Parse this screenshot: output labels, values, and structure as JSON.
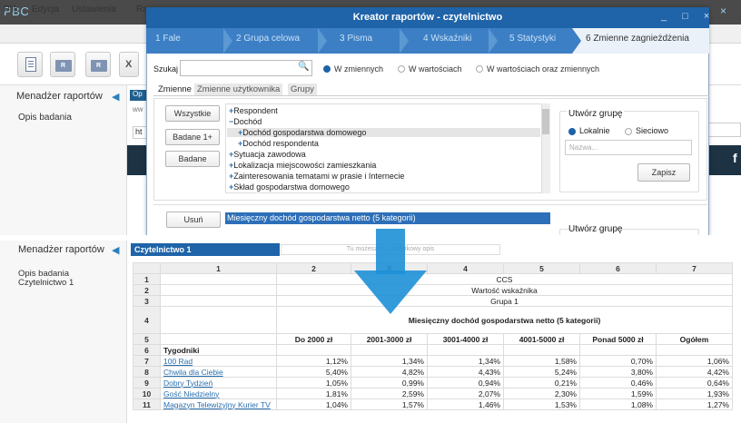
{
  "app": {
    "logo": "PBC",
    "window_controls": "_ □ ×"
  },
  "menu": [
    "Plik",
    "Edycja",
    "Ustawienia",
    "Ra"
  ],
  "toolbar": {
    "btn2_label": "R",
    "btn3_label": "R",
    "btn4_label": "X"
  },
  "top_panel": {
    "title": "Menadżer raportów",
    "item": "Opis badania",
    "strip_tab": "Op",
    "strip_ww": "ww",
    "strip_ht": "ht",
    "dark_letter": "f"
  },
  "dialog": {
    "title": "Kreator raportów - czytelnictwo",
    "controls": "_ □ ×",
    "steps": [
      "1 Fale",
      "2 Grupa celowa",
      "3 Pisma",
      "4 Wskaźniki",
      "5 Statystyki",
      "6 Zmienne zagnieżdżenia"
    ],
    "search": {
      "label": "Szukaj",
      "value": ""
    },
    "radios": [
      "W zmiennych",
      "W wartościach",
      "W wartościach oraz zmiennych"
    ],
    "subtabs": [
      "Zmienne",
      "Zmienne użytkownika",
      "Grupy"
    ],
    "buttons": {
      "all": "Wszystkie",
      "studied_plus": "Badane 1+",
      "studied": "Badane",
      "remove": "Usuń",
      "save": "Zapisz"
    },
    "tree": [
      {
        "prefix": "+",
        "label": "Respondent"
      },
      {
        "prefix": "−",
        "label": "Dochód"
      },
      {
        "prefix": "+",
        "label": "Dochód gospodarstwa domowego"
      },
      {
        "prefix": "+",
        "label": "Dochód respondenta"
      },
      {
        "prefix": "+",
        "label": "Sytuacja zawodowa"
      },
      {
        "prefix": "+",
        "label": "Lokalizacja miejscowości zamieszkania"
      },
      {
        "prefix": "+",
        "label": "Zainteresowania tematami w prasie i Internecie"
      },
      {
        "prefix": "+",
        "label": "Skład gospodarstwa domowego"
      }
    ],
    "group": {
      "title": "Utwórz grupę",
      "local": "Lokalnie",
      "network": "Sieciowo",
      "name_placeholder": "Nazwa..."
    },
    "selected_variable": "Miesięczny dochód gospodarstwa netto (5 kategorii)",
    "group2_title": "Utwórz grupę"
  },
  "bottom_panel": {
    "title": "Menadżer raportów",
    "items": [
      "Opis badania",
      "Czytelnictwo 1"
    ]
  },
  "doc": {
    "tab": "Czytelnictwo 1",
    "desc_placeholder": "Tu możesz w... dodatkowy opis"
  },
  "table": {
    "col_headers": [
      "1",
      "2",
      "3",
      "4",
      "5",
      "6",
      "7"
    ],
    "rows": [
      {
        "n": "1",
        "merged": "CCS"
      },
      {
        "n": "2",
        "merged": "Wartość wskaźnika"
      },
      {
        "n": "3",
        "merged": "Grupa 1"
      },
      {
        "n": "4",
        "merged": "Miesięczny dochód gospodarstwa netto (5 kategorii)"
      },
      {
        "n": "5",
        "cells": [
          "",
          "Do 2000 zł",
          "2001-3000 zł",
          "3001-4000 zł",
          "4001-5000 zł",
          "Ponad 5000 zł",
          "Ogółem"
        ]
      },
      {
        "n": "6",
        "cells": [
          "Tygodniki",
          "",
          "",
          "",
          "",
          "",
          ""
        ]
      },
      {
        "n": "7",
        "cells": [
          "100 Rad",
          "1,12%",
          "1,34%",
          "1,34%",
          "1,58%",
          "0,70%",
          "1,06%"
        ]
      },
      {
        "n": "8",
        "cells": [
          "Chwila dla Ciebie",
          "5,40%",
          "4,82%",
          "4,43%",
          "5,24%",
          "3,80%",
          "4,42%"
        ]
      },
      {
        "n": "9",
        "cells": [
          "Dobry Tydzień",
          "1,05%",
          "0,99%",
          "0,94%",
          "0,21%",
          "0,46%",
          "0,64%"
        ]
      },
      {
        "n": "10",
        "cells": [
          "Gość Niedzielny",
          "1,81%",
          "2,59%",
          "2,07%",
          "2,30%",
          "1,59%",
          "1,93%"
        ]
      },
      {
        "n": "11",
        "cells": [
          "Magazyn Telewizyjny Kurier TV",
          "1,04%",
          "1,57%",
          "1,46%",
          "1,53%",
          "1,08%",
          "1,27%"
        ]
      }
    ]
  },
  "colors": {
    "accent": "#1f63a8",
    "wizard": "#3c7fc4",
    "arrow": "#1e90d6"
  }
}
